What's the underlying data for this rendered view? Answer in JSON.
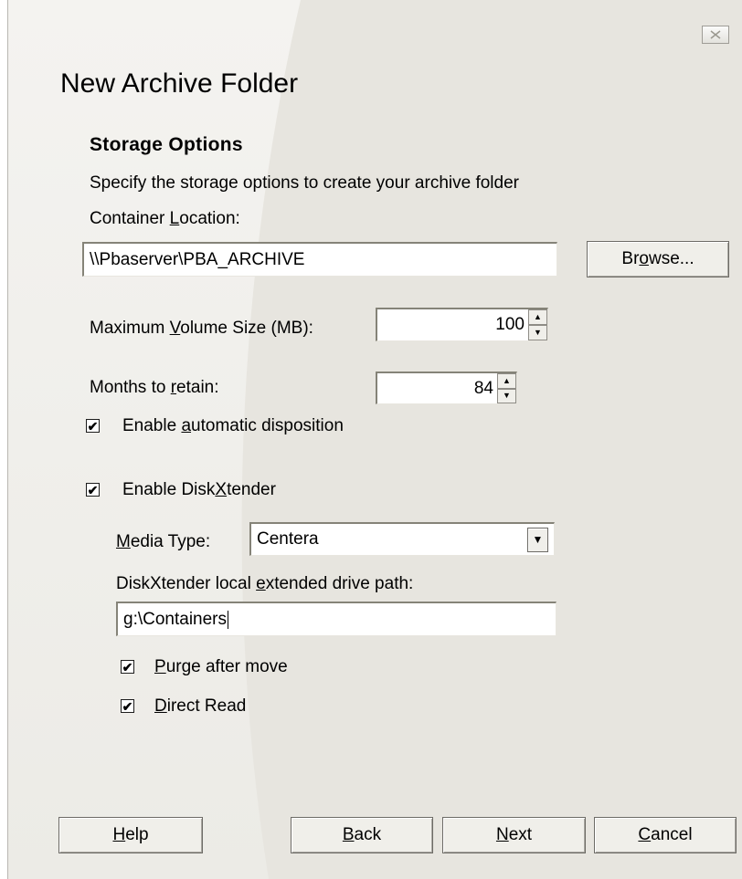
{
  "dialog": {
    "title": "New Archive Folder",
    "close_icon": "close-icon"
  },
  "section": {
    "title": "Storage Options",
    "description": "Specify the storage options to create your archive folder"
  },
  "container": {
    "label_pre": "Container ",
    "label_key": "L",
    "label_post": "ocation:",
    "value": "\\\\Pbaserver\\PBA_ARCHIVE",
    "browse_pre": "Br",
    "browse_key": "o",
    "browse_post": "wse..."
  },
  "volume": {
    "label_pre": "Maximum ",
    "label_key": "V",
    "label_post": "olume Size (MB):",
    "value": "100"
  },
  "months": {
    "label_pre": "Months to ",
    "label_key": "r",
    "label_post": "etain:",
    "value": "84"
  },
  "disposition": {
    "checked": true,
    "label_pre": "Enable ",
    "label_key": "a",
    "label_post": "utomatic disposition"
  },
  "diskxtender": {
    "checked": true,
    "label_pre": "Enable Disk",
    "label_key": "X",
    "label_post": "tender",
    "media_label_key": "M",
    "media_label_post": "edia Type:",
    "media_value": "Centera",
    "path_label_pre": "DiskXtender local ",
    "path_label_key": "e",
    "path_label_post": "xtended drive path:",
    "path_value": "g:\\Containers",
    "purge": {
      "checked": true,
      "label_key": "P",
      "label_post": "urge after move"
    },
    "direct_read": {
      "checked": true,
      "label_key": "D",
      "label_post": "irect Read"
    }
  },
  "buttons": {
    "help_key": "H",
    "help_post": "elp",
    "back_key": "B",
    "back_post": "ack",
    "next_key": "N",
    "next_post": "ext",
    "cancel_key": "C",
    "cancel_post": "ancel"
  },
  "colors": {
    "background": "#f4f3f0",
    "button_face": "#f0efea",
    "field": "#ffffff"
  },
  "icons": {
    "check": "check-mark-icon",
    "spin_up": "spin-up-icon",
    "spin_down": "spin-down-icon",
    "dropdown": "chevron-down-icon"
  }
}
